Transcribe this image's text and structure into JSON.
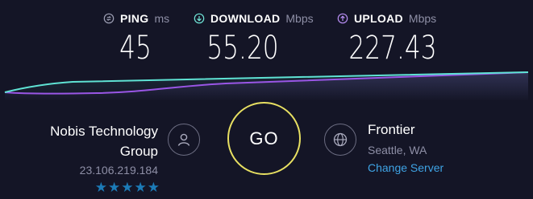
{
  "metrics": {
    "ping": {
      "label": "PING",
      "unit": "ms",
      "value": "45",
      "icon": "ping-icon",
      "color": "#9d9fb4"
    },
    "download": {
      "label": "DOWNLOAD",
      "unit": "Mbps",
      "value": "55.20",
      "icon": "download-arrow-icon",
      "color": "#6fe5d7"
    },
    "upload": {
      "label": "UPLOAD",
      "unit": "Mbps",
      "value": "227.43",
      "icon": "upload-arrow-icon",
      "color": "#b58cf0"
    }
  },
  "graph": {
    "download_color": "#5fe3d4",
    "upload_color": "#9a56e6"
  },
  "isp": {
    "name_line1": "Nobis Technology",
    "name_line2": "Group",
    "ip": "23.106.219.184",
    "rating_stars": 5,
    "rating_color": "#1c7bb7",
    "icon": "user-icon"
  },
  "go_button": {
    "label": "GO",
    "ring_color": "#e8e062"
  },
  "server": {
    "name": "Frontier",
    "location": "Seattle, WA",
    "change_label": "Change Server",
    "icon": "globe-icon",
    "link_color": "#3fa4e5"
  },
  "colors": {
    "background": "#141526",
    "muted_text": "#8e8fa6"
  }
}
